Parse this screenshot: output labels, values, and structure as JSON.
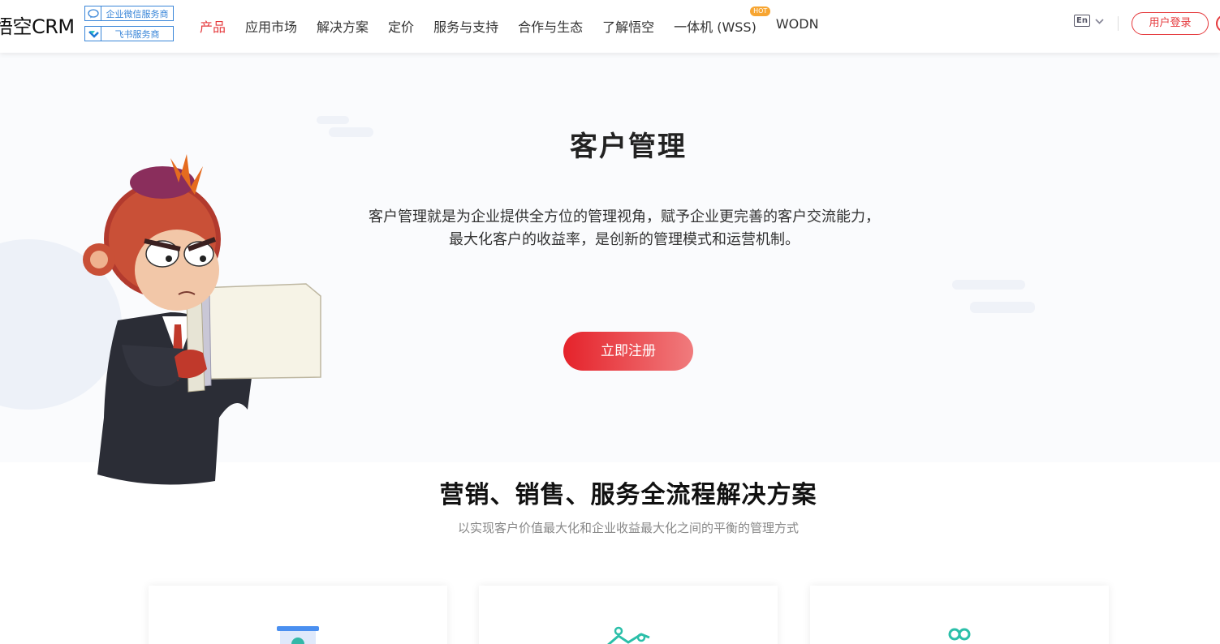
{
  "header": {
    "logo": "悟空CRM",
    "partners": [
      {
        "label": "企业微信服务商",
        "icon": "wechat-work-icon"
      },
      {
        "label": "飞书服务商",
        "icon": "feishu-icon"
      }
    ],
    "nav": [
      {
        "label": "产品",
        "active": true
      },
      {
        "label": "应用市场"
      },
      {
        "label": "解决方案"
      },
      {
        "label": "定价"
      },
      {
        "label": "服务与支持"
      },
      {
        "label": "合作与生态"
      },
      {
        "label": "了解悟空"
      },
      {
        "label": "一体机 (WSS)",
        "badge": "HOT"
      },
      {
        "label": "WODN"
      }
    ],
    "lang": "En",
    "login": "用户登录",
    "accent": "#e5393c"
  },
  "hero": {
    "title": "客户管理",
    "desc_line1": "客户管理就是为企业提供全方位的管理视角，赋予企业更完善的客户交流能力，",
    "desc_line2": "最大化客户的收益率，是创新的管理模式和运营机制。",
    "cta": "立即注册"
  },
  "section": {
    "title": "营销、销售、服务全流程解决方案",
    "subtitle": "以实现客户价值最大化和企业收益最大化之间的平衡的管理方式"
  },
  "cards": [
    {
      "icon": "chart-board-icon"
    },
    {
      "icon": "line-trend-icon"
    },
    {
      "icon": "people-icon"
    }
  ]
}
